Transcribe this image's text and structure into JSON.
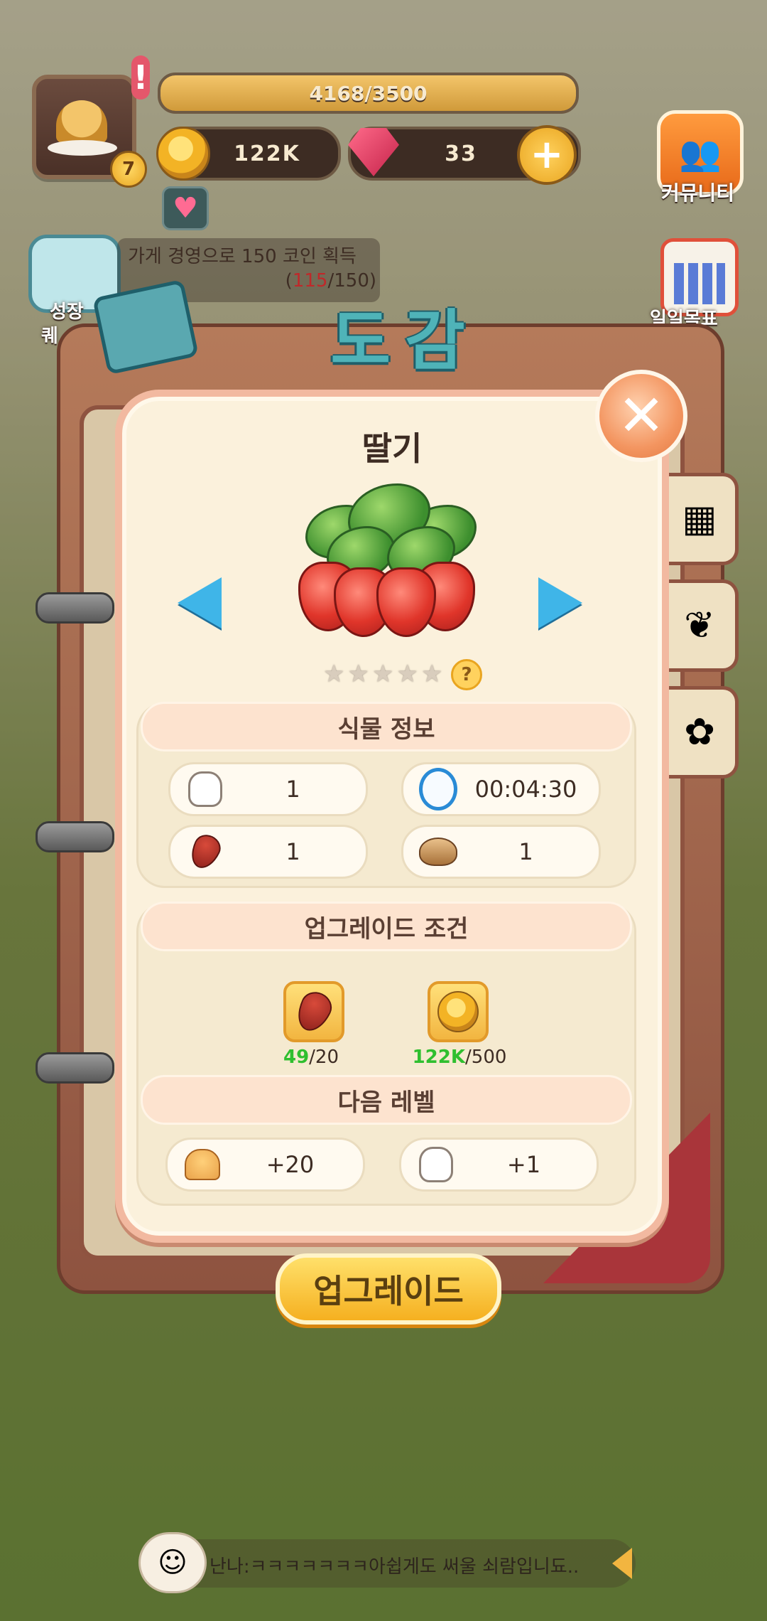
{
  "hud": {
    "xp_text": "4168/3500",
    "xp_fraction": 1.0,
    "coins": "122K",
    "gems": "33",
    "level": "7",
    "community_label": "커뮤니티"
  },
  "quest": {
    "text": "가게 경영으로 150 코인 획득",
    "progress_current": "115",
    "progress_total": "/150)",
    "progress_open": "("
  },
  "side_labels": {
    "growth": "성장",
    "quest_short": "퀘",
    "daily_goal": "일일목표"
  },
  "book": {
    "title": "도감"
  },
  "plant": {
    "name": "딸기",
    "stars_total": 5,
    "stars_filled": 0
  },
  "sections": {
    "info_header": "식물 정보",
    "upgrade_header": "업그레이드 조건",
    "next_header": "다음 레벨"
  },
  "info": {
    "tooth_value": "1",
    "time_value": "00:04:30",
    "seed_value": "1",
    "water_value": "1"
  },
  "upgrade_req": {
    "seed_have": "49",
    "seed_need": "/20",
    "coin_have": "122K",
    "coin_need": "/500"
  },
  "next_level": {
    "muffin_bonus": "+20",
    "tooth_bonus": "+1"
  },
  "upgrade_button": "업그레이드",
  "chat": {
    "message": "난나:ㅋㅋㅋㅋㅋㅋㅋ아쉽게도 써울 쇠람입니됴..."
  },
  "icons": {
    "close": "close-icon",
    "prev": "arrow-left-icon",
    "next": "arrow-right-icon",
    "help": "help-icon",
    "tooth": "tooth-icon",
    "clock": "alarm-clock-icon",
    "seed": "seed-icon",
    "watering_can": "watering-can-icon",
    "coin": "coin-icon",
    "gem": "gem-icon",
    "muffin": "muffin-icon"
  },
  "colors": {
    "accent_orange": "#f39560",
    "modal_bg": "#fbf1dc",
    "button_yellow": "#f5b020",
    "have_green": "#2fbf2f",
    "progress_red": "#c0282a",
    "arrow_blue": "#3fb5e8"
  }
}
